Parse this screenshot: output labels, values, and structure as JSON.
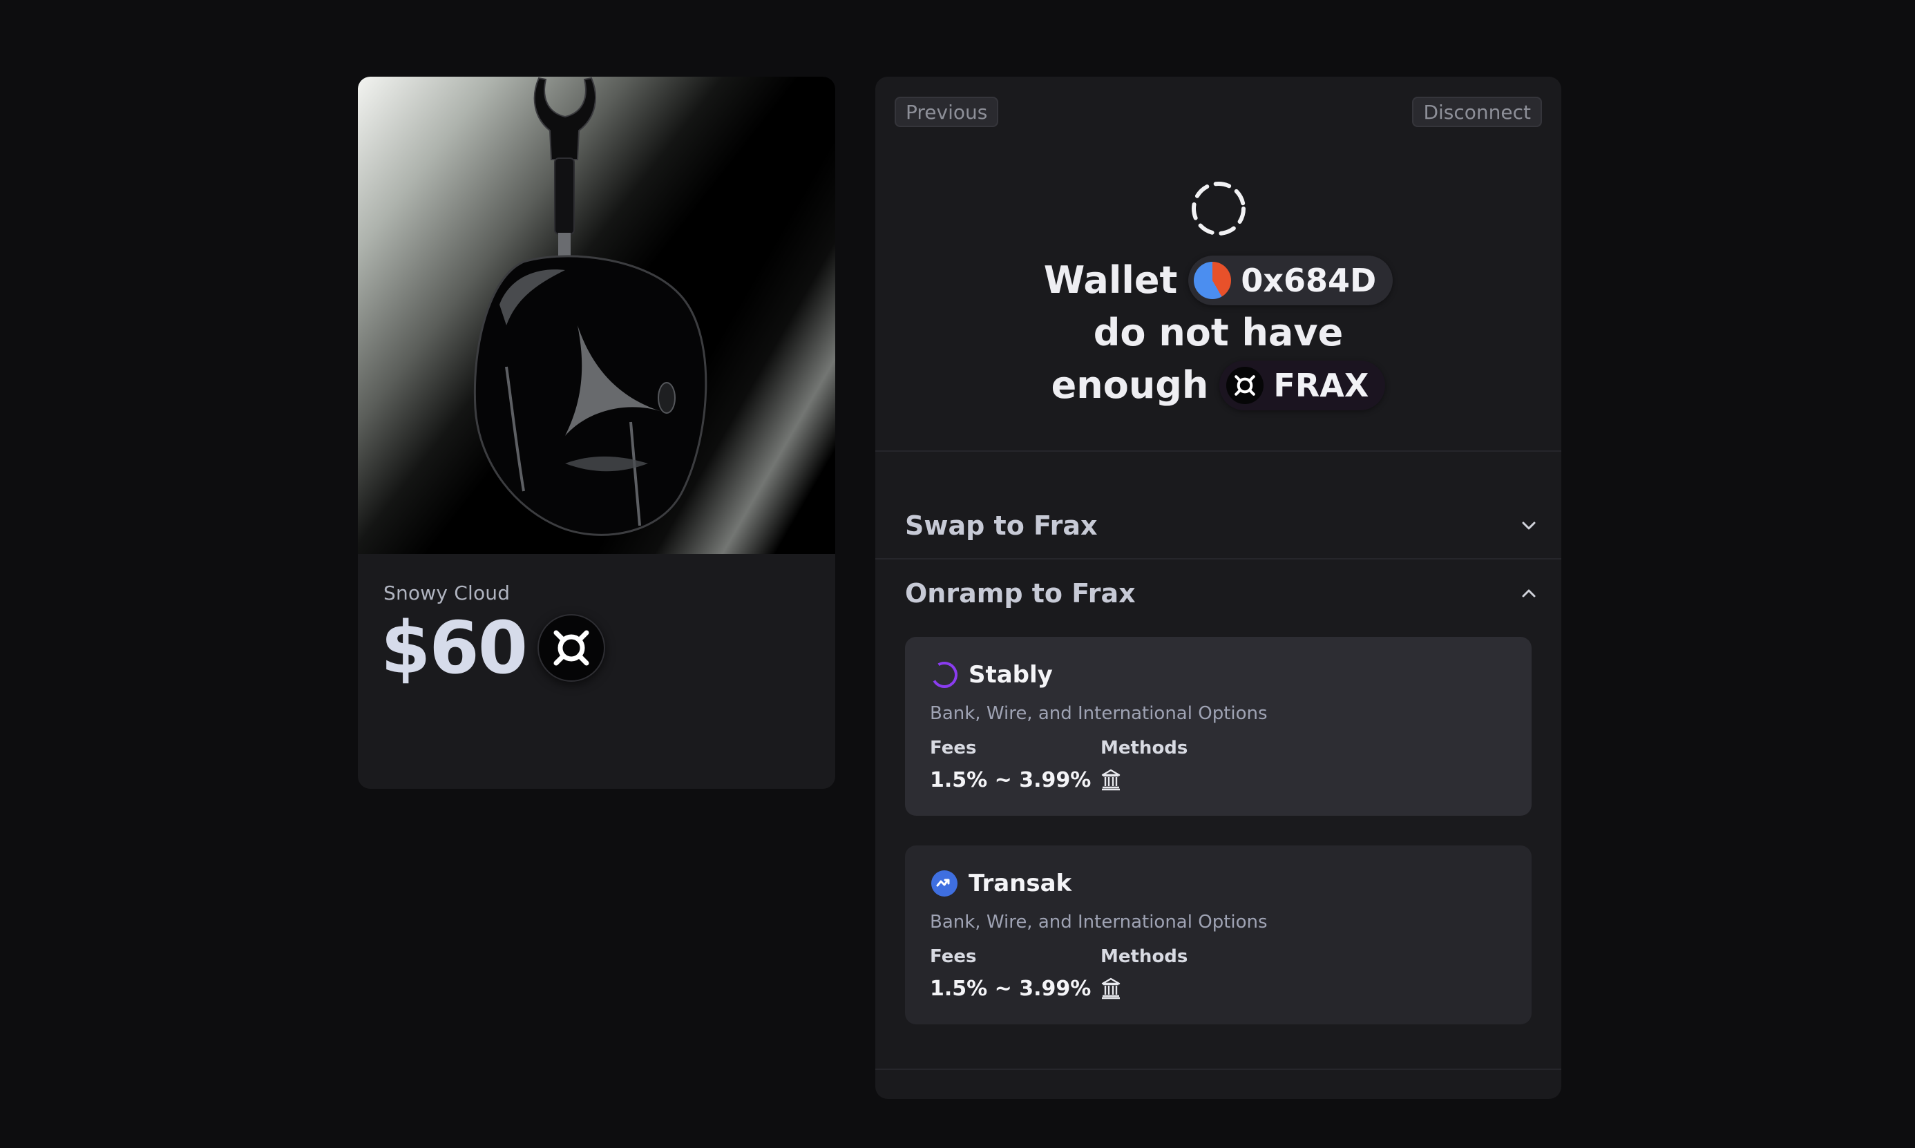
{
  "product": {
    "name": "Snowy Cloud",
    "price": "$60",
    "currency_icon": "frax-token-icon",
    "image_subject": "black headphone speaker in light beam"
  },
  "header": {
    "previous_label": "Previous",
    "disconnect_label": "Disconnect"
  },
  "status": {
    "icon": "spinner-icon",
    "line1_text": "Wallet",
    "wallet_address": "0x684D",
    "line2_text": "do not have",
    "line3_text": "enough",
    "token_symbol": "FRAX"
  },
  "sections": {
    "swap": {
      "title": "Swap to Frax",
      "expanded": false
    },
    "onramp": {
      "title": "Onramp to Frax",
      "expanded": true
    }
  },
  "providers": [
    {
      "name": "Stably",
      "icon": "stably-logo-icon",
      "description": "Bank, Wire, and International Options",
      "fees_label": "Fees",
      "fees_value": "1.5% ~ 3.99%",
      "methods_label": "Methods",
      "method_icon": "bank-icon"
    },
    {
      "name": "Transak",
      "icon": "transak-logo-icon",
      "description": "Bank, Wire, and International Options",
      "fees_label": "Fees",
      "fees_value": "1.5% ~ 3.99%",
      "methods_label": "Methods",
      "method_icon": "bank-icon"
    }
  ],
  "colors": {
    "background": "#0d0d0f",
    "panel": "#1a1a1d",
    "card_highlight": "#2d2d33",
    "stably_purple": "#8a3cf0",
    "transak_blue": "#3f6fe0"
  }
}
